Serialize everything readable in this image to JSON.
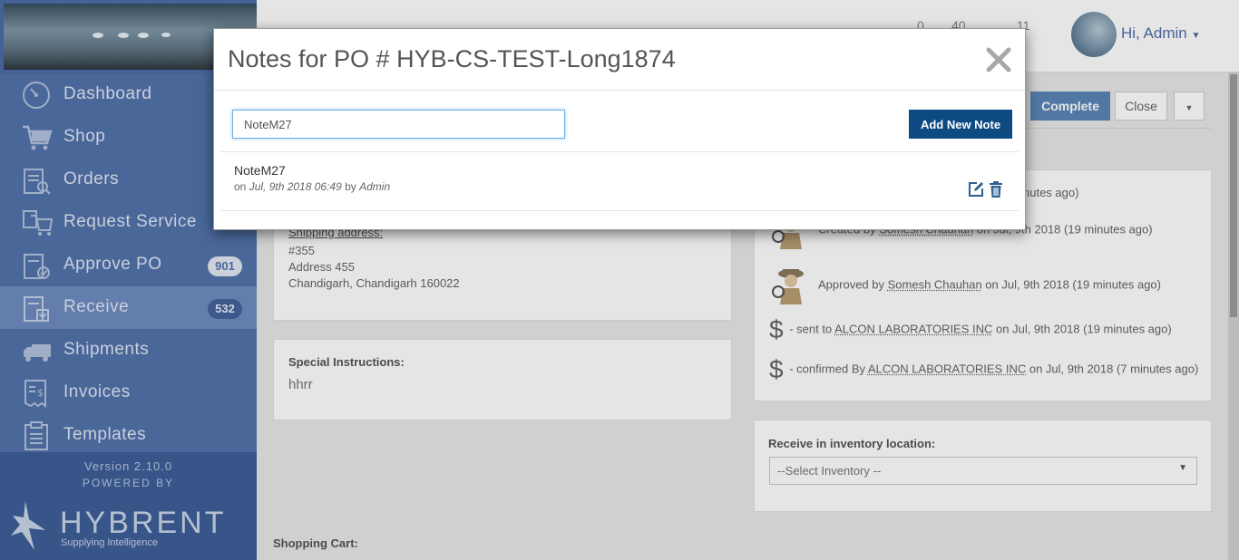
{
  "sidebar": {
    "items": [
      {
        "label": "Dashboard",
        "icon": "dashboard-icon"
      },
      {
        "label": "Shop",
        "icon": "cart-icon"
      },
      {
        "label": "Orders",
        "icon": "orders-icon"
      },
      {
        "label": "Request Service",
        "icon": "request-service-icon"
      },
      {
        "label": "Approve PO",
        "icon": "approve-po-icon",
        "badge": "901"
      },
      {
        "label": "Receive",
        "icon": "receive-icon",
        "badge": "532"
      },
      {
        "label": "Shipments",
        "icon": "truck-icon"
      },
      {
        "label": "Invoices",
        "icon": "invoice-icon"
      },
      {
        "label": "Templates",
        "icon": "templates-icon"
      }
    ],
    "active_item": "Receive",
    "version": "Version 2.10.0",
    "powered_by": "POWERED BY",
    "brand_name": "HYBRENT",
    "brand_tagline": "Supplying Intelligence"
  },
  "header": {
    "counters": [
      "0",
      "40",
      "11"
    ],
    "greeting": "Hi, Admin",
    "buttons": {
      "complete": "Complete",
      "close": "Close"
    }
  },
  "shipping": {
    "heading": "Shipping address:",
    "lines": [
      "#355",
      "Address 455",
      "Chandigarh, Chandigarh 160022"
    ]
  },
  "special": {
    "heading": "Special Instructions:",
    "value": "hhrr"
  },
  "activity": {
    "partial_top": "nutes ago)",
    "created": {
      "prefix": "Created by ",
      "user": "Somesh Chauhan",
      "suffix": " on Jul, 9th 2018 (19 minutes ago)"
    },
    "approved": {
      "prefix": "Approved by ",
      "user": "Somesh Chauhan",
      "suffix": " on Jul, 9th 2018 (19 minutes ago)"
    },
    "sent": {
      "symbol": "$",
      "prefix": " - sent to ",
      "vendor": "ALCON LABORATORIES INC",
      "suffix": " on Jul, 9th 2018 (19 minutes ago)"
    },
    "confirmed": {
      "symbol": "$",
      "prefix": " - confirmed By ",
      "vendor": "ALCON LABORATORIES INC",
      "suffix": " on Jul, 9th 2018 (7 minutes ago)"
    }
  },
  "receive": {
    "heading": "Receive in inventory location:",
    "select_value": "--Select Inventory --"
  },
  "cart": {
    "heading": "Shopping Cart:"
  },
  "modal": {
    "title": "Notes for PO # HYB-CS-TEST-Long1874",
    "input_value": "NoteM27",
    "add_button": "Add New Note",
    "note": {
      "title": "NoteM27",
      "on": "on ",
      "date": "Jul, 9th 2018 06:49",
      "by": " by ",
      "author": "Admin"
    }
  },
  "colors": {
    "sidebar": "#5373ac",
    "primary_button": "#0e4a82",
    "accent": "#4d6ea8",
    "action_icon": "#2d5f8f"
  }
}
